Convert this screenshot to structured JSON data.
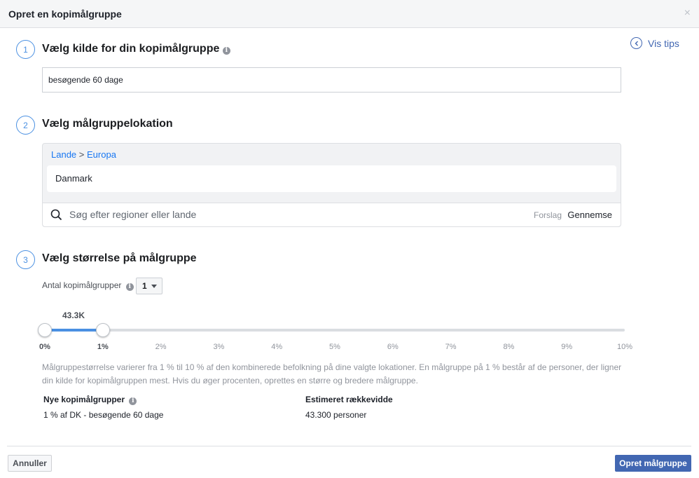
{
  "dialog": {
    "title": "Opret en kopimålgruppe",
    "close_glyph": "×"
  },
  "tips": {
    "label": "Vis tips",
    "icon": "chevron-left-circle-icon"
  },
  "step1": {
    "number": "1",
    "title": "Vælg kilde for din kopimålgruppe",
    "source_value": "besøgende 60 dage"
  },
  "step2": {
    "number": "2",
    "title": "Vælg målgruppelokation",
    "breadcrumb": {
      "root": "Lande",
      "separator": ">",
      "current": "Europa"
    },
    "selected_location": "Danmark",
    "search_placeholder": "Søg efter regioner eller lande",
    "suggestions_label": "Forslag",
    "browse_label": "Gennemse"
  },
  "step3": {
    "number": "3",
    "title": "Vælg størrelse på målgruppe",
    "count_label": "Antal kopimålgrupper",
    "count_value": "1",
    "slider": {
      "value_label": "43.3K",
      "range_start_percent": 0,
      "range_end_percent": 1,
      "max_percent": 10,
      "ticks": [
        "0%",
        "1%",
        "2%",
        "3%",
        "4%",
        "5%",
        "6%",
        "7%",
        "8%",
        "9%",
        "10%"
      ]
    },
    "description": "Målgruppestørrelse varierer fra 1 % til 10 % af den kombinerede befolkning på dine valgte lokationer. En målgruppe på 1 % består af de personer, der ligner din kilde for kopimålgruppen mest. Hvis du øger procenten, oprettes en større og bredere målgruppe.",
    "new_audiences_header": "Nye kopimålgrupper",
    "new_audiences_value": "1 % af DK - besøgende 60 dage",
    "reach_header": "Estimeret rækkevidde",
    "reach_value": "43.300 personer"
  },
  "footer": {
    "cancel_label": "Annuller",
    "create_label": "Opret målgruppe"
  },
  "colors": {
    "accent": "#4a90e2",
    "primary_button": "#4267b2",
    "link": "#1877f2"
  }
}
